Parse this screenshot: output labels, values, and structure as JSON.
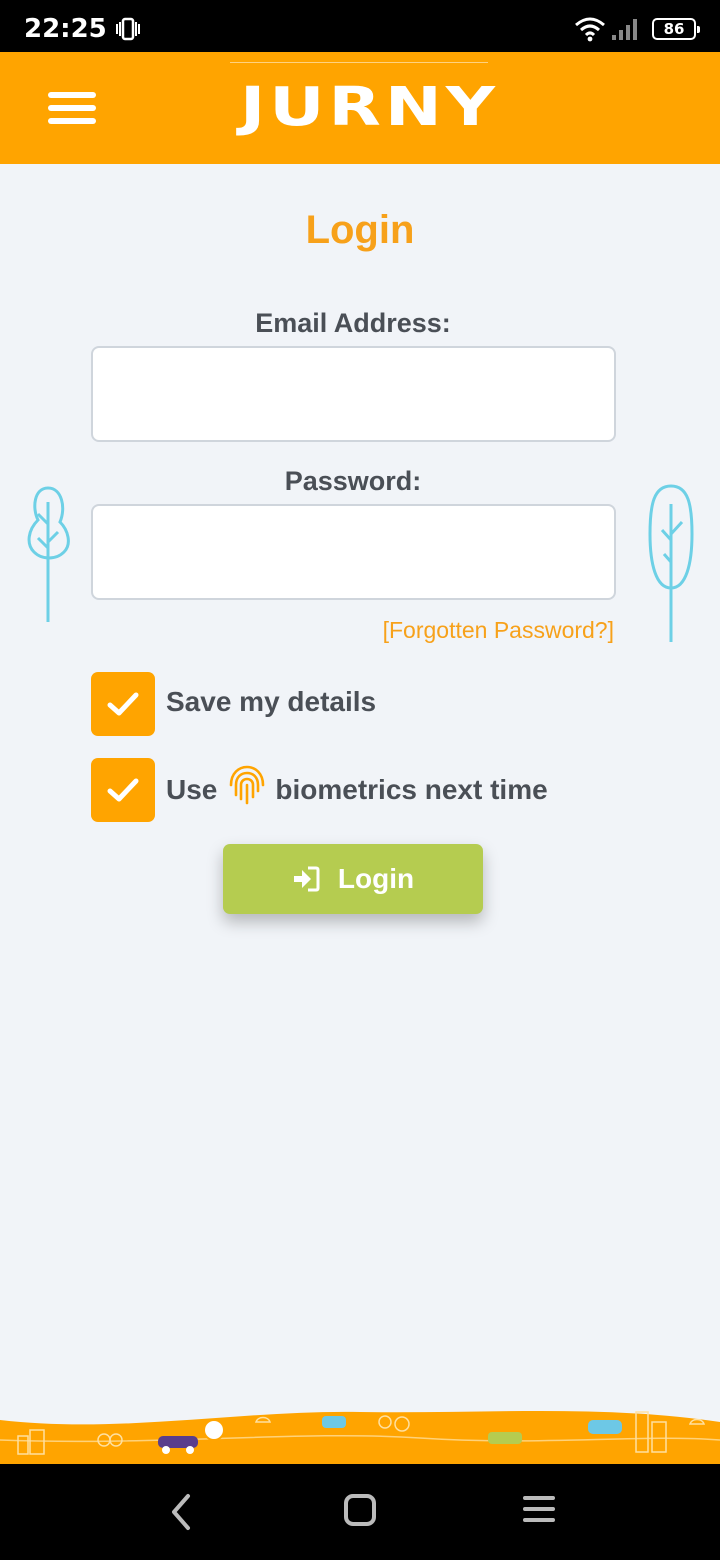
{
  "status_bar": {
    "time": "22:25",
    "battery": "86",
    "icons": [
      "vibrate-icon",
      "wifi-icon",
      "signal-icon",
      "battery-icon"
    ]
  },
  "header": {
    "logo_text": "JURNY",
    "menu_icon": "hamburger-menu-icon",
    "brand_color": "#ffa400"
  },
  "login_form": {
    "title": "Login",
    "email_label": "Email Address:",
    "email_value": "",
    "password_label": "Password:",
    "password_value": "",
    "forgot_password": "[Forgotten Password?]",
    "save_details": {
      "label": "Save my details",
      "checked": true
    },
    "biometrics": {
      "label_before": "Use",
      "label_after": "biometrics next time",
      "checked": true,
      "icon": "fingerprint-icon"
    },
    "login_button": "Login",
    "login_button_icon": "sign-in-icon",
    "button_color": "#b5cc50",
    "accent_color": "#f7a11a"
  },
  "nav_bar": {
    "icons": [
      "back-icon",
      "home-icon",
      "recents-icon"
    ]
  }
}
